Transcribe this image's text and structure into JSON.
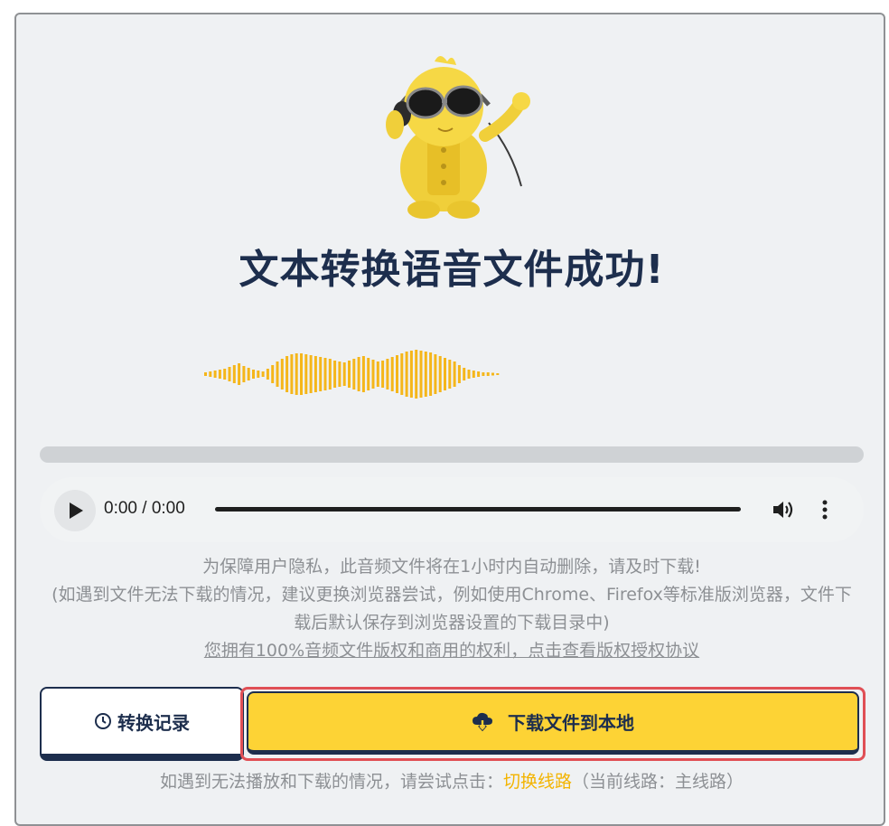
{
  "title": "文本转换语音文件成功!",
  "player": {
    "time": "0:00 / 0:00",
    "progress": 0
  },
  "notice": {
    "line1": "为保障用户隐私，此音频文件将在1小时内自动删除，请及时下载!",
    "line2": "(如遇到文件无法下载的情况，建议更换浏览器尝试，例如使用Chrome、Firefox等标准版浏览器，文件下载后默认保存到浏览器设置的下载目录中)",
    "license_link": "您拥有100%音频文件版权和商用的权利，点击查看版权授权协议"
  },
  "buttons": {
    "history_label": "转换记录",
    "download_label": "下载文件到本地"
  },
  "footer": {
    "prefix": "如遇到无法播放和下载的情况，请尝试点击：",
    "switch_link": "切换线路",
    "suffix": "（当前线路：主线路）"
  },
  "colors": {
    "accent_yellow": "#fdd335",
    "wave_yellow": "#f5b61a",
    "navy": "#1d2e4d",
    "highlight_red": "#e04f55"
  },
  "icons": {
    "play": "play-icon",
    "volume": "volume-icon",
    "more": "more-vertical-icon",
    "history": "clock-icon",
    "download": "cloud-download-icon"
  }
}
